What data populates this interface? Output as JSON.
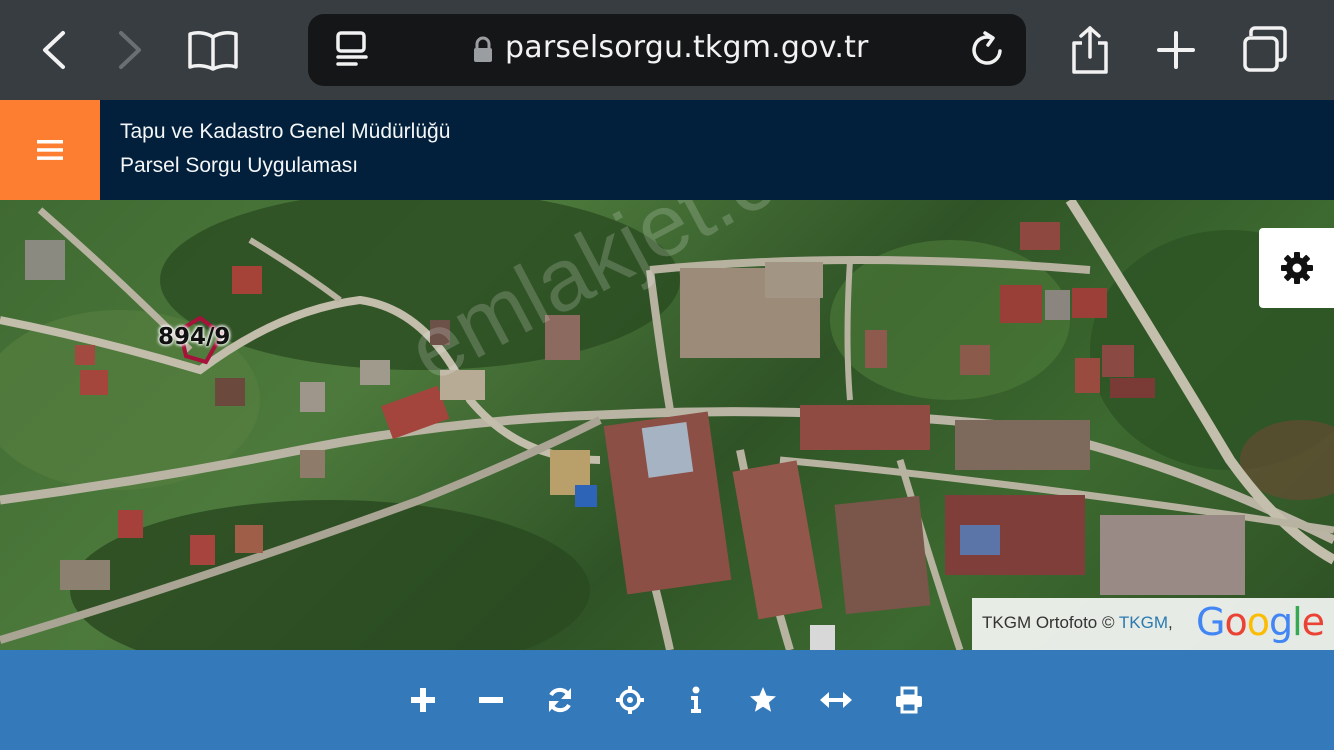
{
  "browser": {
    "url": "parselsorgu.tkgm.gov.tr",
    "icons": [
      "back-icon",
      "forward-icon",
      "bookmarks-icon",
      "reader-icon",
      "lock-icon",
      "reload-icon",
      "share-icon",
      "new-tab-icon",
      "tabs-icon"
    ]
  },
  "header": {
    "org_name": "Tapu ve Kadastro Genel Müdürlüğü",
    "app_name": "Parsel Sorgu Uygulaması",
    "accent_color": "#fd7e31",
    "background_color": "#02203b"
  },
  "map": {
    "parcel_label": "894/9",
    "watermark": "emlakjet.com",
    "attribution_prefix": "TKGM Ortofoto © ",
    "attribution_link": "TKGM",
    "attribution_suffix": ",",
    "provider_logo": "Google"
  },
  "toolbar": {
    "background_color": "#3479b9",
    "tools": [
      "zoom-in-icon",
      "zoom-out-icon",
      "refresh-icon",
      "locate-icon",
      "info-icon",
      "favorite-icon",
      "measure-icon",
      "print-icon"
    ]
  }
}
